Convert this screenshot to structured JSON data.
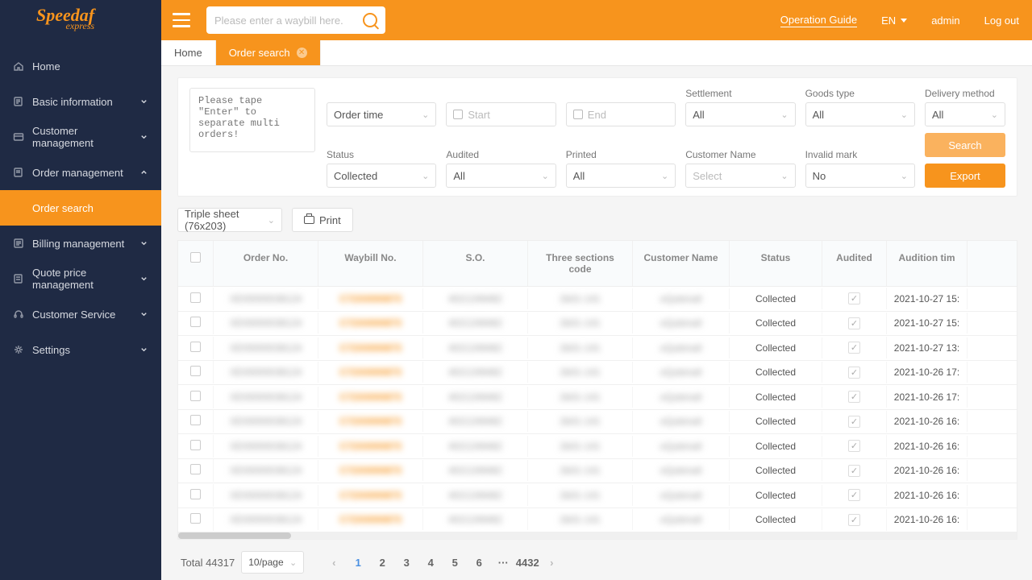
{
  "brand": {
    "name": "Speedaf",
    "sub": "express"
  },
  "topbar": {
    "search_placeholder": "Please enter a waybill here.",
    "operation_guide": "Operation Guide",
    "lang": "EN",
    "user": "admin",
    "logout": "Log out"
  },
  "sidebar": {
    "items": [
      {
        "label": "Home",
        "icon": "home",
        "expandable": false
      },
      {
        "label": "Basic information",
        "icon": "doc",
        "expandable": true
      },
      {
        "label": "Customer management",
        "icon": "card",
        "expandable": true
      },
      {
        "label": "Order management",
        "icon": "order",
        "expandable": true,
        "open": true,
        "children": [
          {
            "label": "Order search",
            "active": true
          }
        ]
      },
      {
        "label": "Billing management",
        "icon": "billing",
        "expandable": true
      },
      {
        "label": "Quote price management",
        "icon": "quote",
        "expandable": true
      },
      {
        "label": "Customer Service",
        "icon": "headset",
        "expandable": true
      },
      {
        "label": "Settings",
        "icon": "gear",
        "expandable": true
      }
    ]
  },
  "tabs": [
    {
      "label": "Home",
      "active": false
    },
    {
      "label": "Order search",
      "active": true,
      "closable": true
    }
  ],
  "filters": {
    "multi_placeholder": "Please tape \"Enter\" to separate multi orders!",
    "order_time": {
      "value": "Order time"
    },
    "start": {
      "placeholder": "Start"
    },
    "end": {
      "placeholder": "End"
    },
    "settlement": {
      "label": "Settlement",
      "value": "All"
    },
    "goods_type": {
      "label": "Goods type",
      "value": "All"
    },
    "delivery": {
      "label": "Delivery method",
      "value": "All"
    },
    "status": {
      "label": "Status",
      "value": "Collected"
    },
    "audited": {
      "label": "Audited",
      "value": "All"
    },
    "printed": {
      "label": "Printed",
      "value": "All"
    },
    "customer": {
      "label": "Customer Name",
      "placeholder": "Select"
    },
    "invalid": {
      "label": "Invalid mark",
      "value": "No"
    },
    "search_btn": "Search",
    "export_btn": "Export"
  },
  "actions": {
    "sheet_select": "Triple sheet (76x203)",
    "print": "Print"
  },
  "table": {
    "headers": [
      "Order No.",
      "Waybill No.",
      "S.O.",
      "Three sections code",
      "Customer Name",
      "Status",
      "Audited",
      "Audition tim"
    ],
    "rows": [
      {
        "status": "Collected",
        "audited": true,
        "time": "2021-10-27 15:"
      },
      {
        "status": "Collected",
        "audited": true,
        "time": "2021-10-27 15:"
      },
      {
        "status": "Collected",
        "audited": true,
        "time": "2021-10-27 13:"
      },
      {
        "status": "Collected",
        "audited": true,
        "time": "2021-10-26 17:"
      },
      {
        "status": "Collected",
        "audited": true,
        "time": "2021-10-26 17:"
      },
      {
        "status": "Collected",
        "audited": true,
        "time": "2021-10-26 16:"
      },
      {
        "status": "Collected",
        "audited": true,
        "time": "2021-10-26 16:"
      },
      {
        "status": "Collected",
        "audited": true,
        "time": "2021-10-26 16:"
      },
      {
        "status": "Collected",
        "audited": true,
        "time": "2021-10-26 16:"
      },
      {
        "status": "Collected",
        "audited": true,
        "time": "2021-10-26 16:"
      }
    ]
  },
  "pagination": {
    "total_label": "Total 44317",
    "per_page": "10/page",
    "pages": [
      "1",
      "2",
      "3",
      "4",
      "5",
      "6",
      "···",
      "4432"
    ],
    "active": "1"
  }
}
